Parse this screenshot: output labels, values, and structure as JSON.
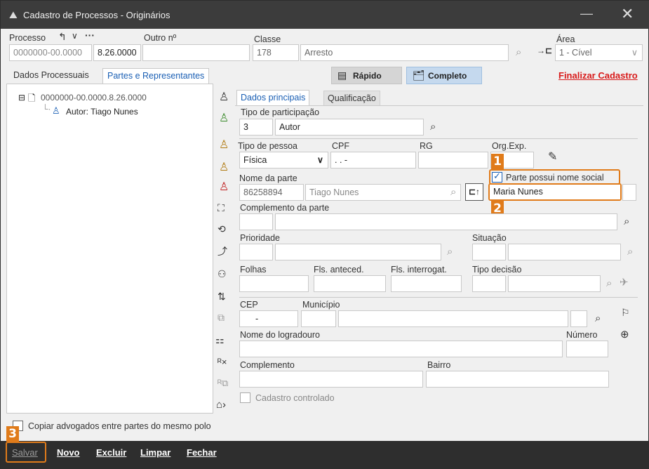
{
  "window": {
    "title": "Cadastro de Processos - Originários",
    "minimize": "—",
    "close": "✕"
  },
  "header": {
    "processo_label": "Processo",
    "processo_value": "0000000-00.0000",
    "processo_suffix": "8.26.0000",
    "outro_label": "Outro nº",
    "outro_value": "",
    "classe_label": "Classe",
    "classe_code": "178",
    "classe_name": "Arresto",
    "area_label": "Área",
    "area_value": "1 - Cível"
  },
  "tabs": {
    "dados_processuais": "Dados Processuais",
    "partes": "Partes e Representantes"
  },
  "view": {
    "rapido": "Rápido",
    "completo": "Completo",
    "finalizar": "Finalizar Cadastro"
  },
  "tree": {
    "root_label": "0000000-00.0000.8.26.0000",
    "child_label": "Autor: Tiago Nunes"
  },
  "subtabs": {
    "dados_principais": "Dados principais",
    "qualificacao": "Qualificação"
  },
  "form": {
    "tipo_participacao_label": "Tipo de participação",
    "tipo_participacao_code": "3",
    "tipo_participacao_name": "Autor",
    "tipo_pessoa_label": "Tipo de pessoa",
    "tipo_pessoa_value": "Física",
    "cpf_label": "CPF",
    "cpf_value": ". . -",
    "rg_label": "RG",
    "rg_value": "",
    "org_exp_label": "Org.Exp.",
    "nome_social_check_label": "Parte possui nome social",
    "nome_parte_label": "Nome da parte",
    "nome_parte_code": "86258894",
    "nome_parte_value": "Tiago Nunes",
    "nome_social_value": "Maria Nunes",
    "complemento_parte_label": "Complemento da parte",
    "prioridade_label": "Prioridade",
    "situacao_label": "Situação",
    "folhas_label": "Folhas",
    "fls_anteced_label": "Fls. anteced.",
    "fls_interrogat_label": "Fls. interrogat.",
    "tipo_decisao_label": "Tipo decisão",
    "cep_label": "CEP",
    "cep_value": "-",
    "municipio_label": "Município",
    "logradouro_label": "Nome do logradouro",
    "numero_label": "Número",
    "complemento_label": "Complemento",
    "bairro_label": "Bairro",
    "cadastro_controlado_label": "Cadastro controlado",
    "copiar_advogados_label": "Copiar advogados entre partes do mesmo polo"
  },
  "buttons": {
    "salvar": "Salvar",
    "novo": "Novo",
    "excluir": "Excluir",
    "limpar": "Limpar",
    "fechar": "Fechar"
  },
  "badges": {
    "one": "1",
    "two": "2",
    "three": "3"
  },
  "colors": {
    "accent": "#1a5fb4",
    "highlight": "#e07b1a",
    "link_red": "#d81b1b"
  }
}
